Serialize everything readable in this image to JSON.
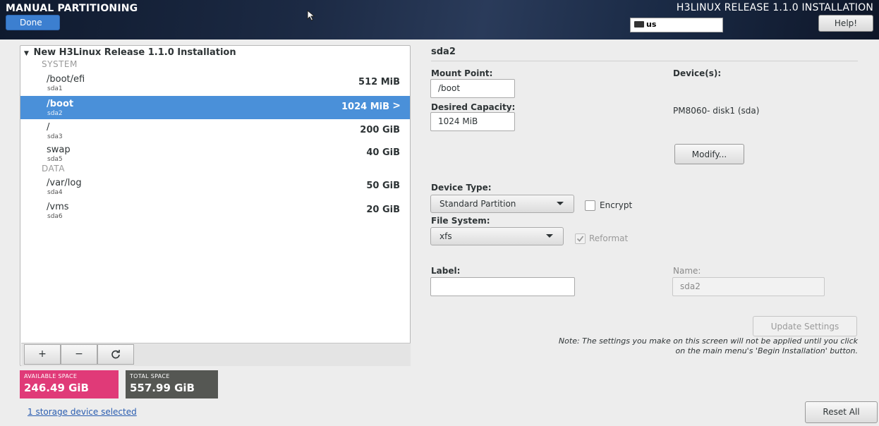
{
  "header": {
    "title": "MANUAL PARTITIONING",
    "done_label": "Done",
    "product": "H3LINUX RELEASE 1.1.0 INSTALLATION",
    "keyboard_layout": "us",
    "help_label": "Help!"
  },
  "tree": {
    "root_label": "New H3Linux Release 1.1.0 Installation",
    "sections": [
      "SYSTEM",
      "DATA"
    ],
    "partitions": [
      {
        "mount": "/boot/efi",
        "device": "sda1",
        "size": "512 MiB"
      },
      {
        "mount": "/boot",
        "device": "sda2",
        "size": "1024 MiB",
        "selected": true
      },
      {
        "mount": "/",
        "device": "sda3",
        "size": "200 GiB"
      },
      {
        "mount": "swap",
        "device": "sda5",
        "size": "40 GiB"
      },
      {
        "mount": "/var/log",
        "device": "sda4",
        "size": "50 GiB"
      },
      {
        "mount": "/vms",
        "device": "sda6",
        "size": "20 GiB"
      }
    ],
    "toolbar": {
      "add": "+",
      "remove": "−",
      "refresh": "C"
    }
  },
  "space": {
    "available_caption": "AVAILABLE SPACE",
    "available_value": "246.49 GiB",
    "total_caption": "TOTAL SPACE",
    "total_value": "557.99 GiB",
    "storage_link": "1 storage device selected"
  },
  "details": {
    "partition_title": "sda2",
    "mount_point_label": "Mount Point:",
    "mount_point_value": "/boot",
    "desired_capacity_label": "Desired Capacity:",
    "desired_capacity_value": "1024 MiB",
    "devices_label": "Device(s):",
    "devices_value": "PM8060- disk1 (sda)",
    "modify_label": "Modify...",
    "device_type_label": "Device Type:",
    "device_type_value": "Standard Partition",
    "encrypt_label": "Encrypt",
    "file_system_label": "File System:",
    "file_system_value": "xfs",
    "reformat_label": "Reformat",
    "label_label": "Label:",
    "label_value": "",
    "name_label": "Name:",
    "name_value": "sda2",
    "update_label": "Update Settings",
    "note": "Note:  The settings you make on this screen will not be applied until you click on the main menu's 'Begin Installation' button.",
    "reset_label": "Reset All"
  },
  "colors": {
    "selection": "#4a90d9",
    "available_badge": "#e03a78",
    "total_badge": "#555753",
    "done_button": "#3c7fd0"
  }
}
